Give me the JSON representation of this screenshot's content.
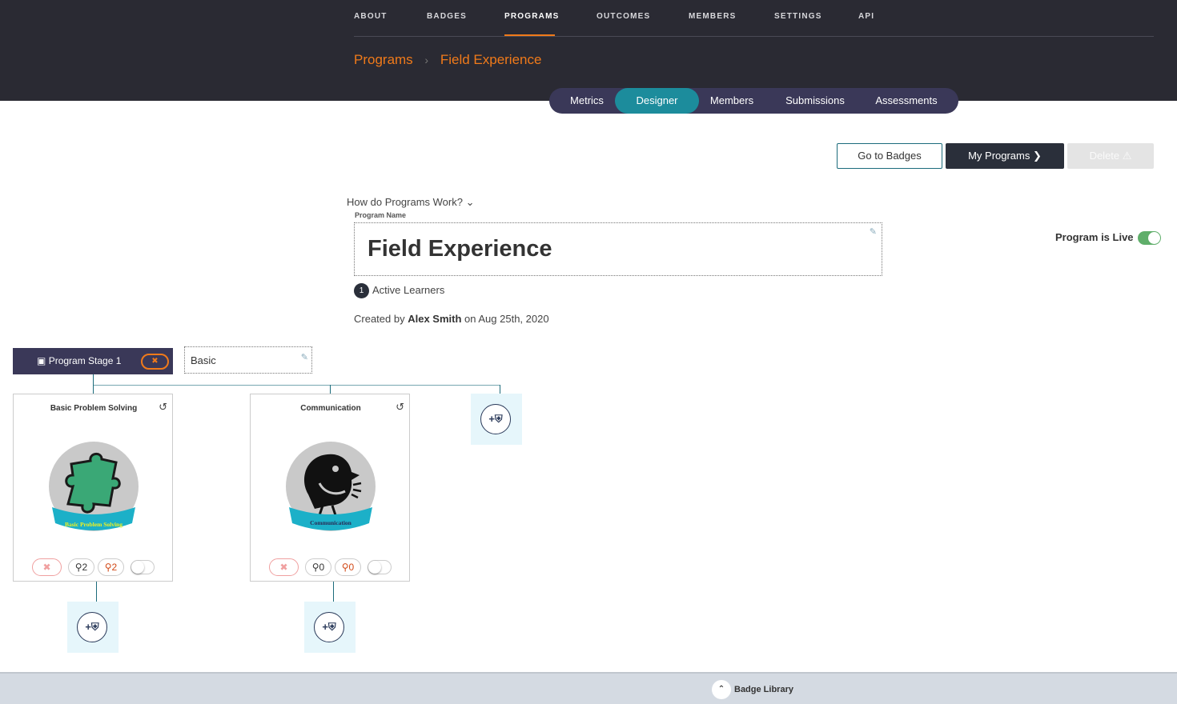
{
  "topnav": {
    "items": [
      "ABOUT",
      "BADGES",
      "PROGRAMS",
      "OUTCOMES",
      "MEMBERS",
      "SETTINGS",
      "API"
    ],
    "active": "PROGRAMS"
  },
  "breadcrumb": {
    "root": "Programs",
    "current": "Field Experience"
  },
  "subtabs": {
    "items": [
      "Metrics",
      "Designer",
      "Members",
      "Submissions",
      "Assessments"
    ],
    "active": "Designer"
  },
  "actions": {
    "go_to_badges": "Go to Badges",
    "my_programs": "My Programs",
    "delete": "Delete"
  },
  "help": {
    "how_label": "How do Programs Work?"
  },
  "program": {
    "name_label": "Program Name",
    "name": "Field Experience",
    "live_label": "Program is Live",
    "live": true,
    "active_count": "1",
    "active_label": "Active Learners",
    "created_prefix": "Created by",
    "created_by": "Alex Smith",
    "created_on": "on Aug 25th, 2020"
  },
  "stage": {
    "label": "Program Stage 1",
    "name": "Basic"
  },
  "badges": [
    {
      "title": "Basic Problem Solving",
      "ribbon": "Basic Problem Solving",
      "count_a": "2",
      "count_b": "2"
    },
    {
      "title": "Communication",
      "ribbon": "Communication",
      "count_a": "0",
      "count_b": "0"
    }
  ],
  "footer": {
    "library_label": "Badge Library"
  },
  "colors": {
    "header_bg": "#2a2a33",
    "accent_orange": "#f07a1a",
    "tab_active": "#1c8c9c",
    "tab_bar": "#3a3858"
  }
}
